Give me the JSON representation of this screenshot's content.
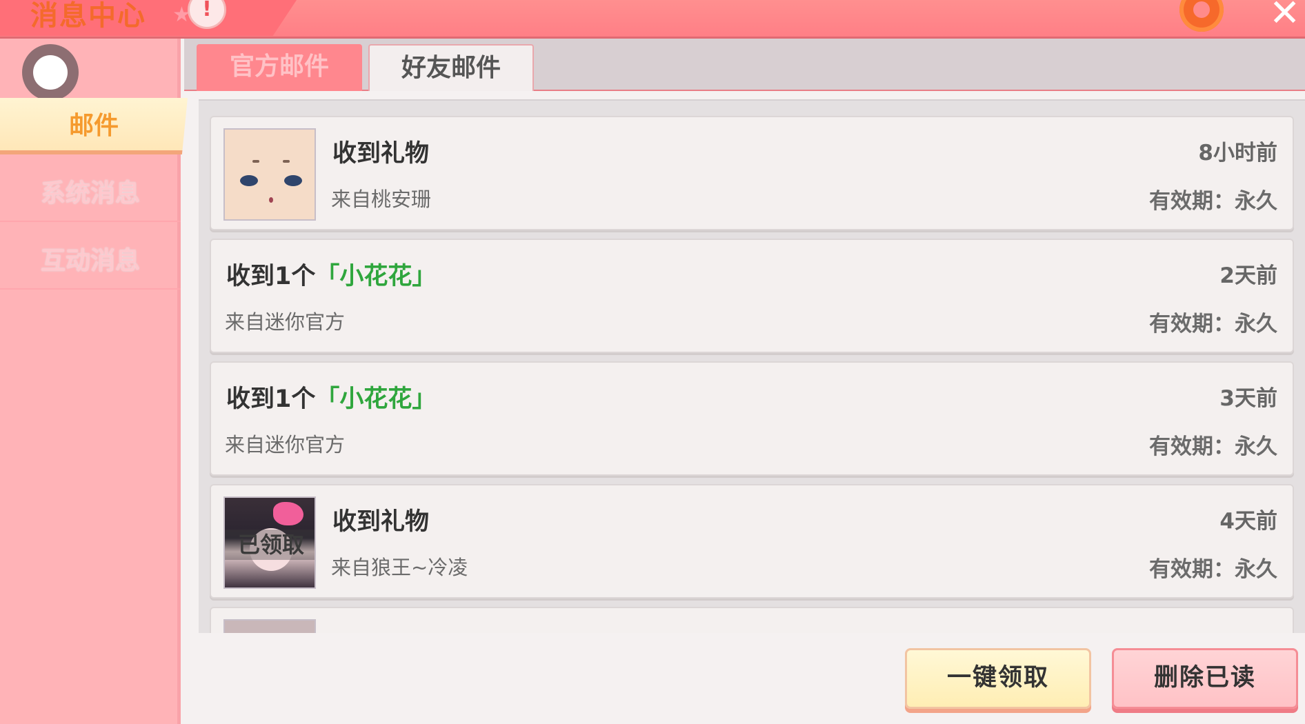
{
  "window": {
    "title": "消息中心",
    "alert_icon": "exclamation-icon",
    "settings_icon": "gear-icon",
    "close_icon": "close-icon",
    "close_glyph": "✕",
    "alert_glyph": "!"
  },
  "sidebar": {
    "items": [
      {
        "label": "邮件",
        "active": true
      },
      {
        "label": "系统消息",
        "active": false
      },
      {
        "label": "互动消息",
        "active": false
      }
    ]
  },
  "tabs": [
    {
      "label": "官方邮件",
      "active": false
    },
    {
      "label": "好友邮件",
      "active": true
    }
  ],
  "mails": [
    {
      "title": "收到礼物",
      "from": "来自桃安珊",
      "time": "8小时前",
      "validity": "有效期：永久",
      "thumb": "character-face-avatar"
    },
    {
      "title_prefix": "收到1个",
      "title_highlight": "「小花花」",
      "from": "来自迷你官方",
      "time": "2天前",
      "validity": "有效期：永久"
    },
    {
      "title_prefix": "收到1个",
      "title_highlight": "「小花花」",
      "from": "来自迷你官方",
      "time": "3天前",
      "validity": "有效期：永久"
    },
    {
      "title": "收到礼物",
      "from": "来自狼王~冷凌",
      "time": "4天前",
      "validity": "有效期：永久",
      "thumb": "character-girl-avatar",
      "status": "已领取"
    }
  ],
  "colors": {
    "title_bar": "#ff8f8f",
    "sidebar": "#ffb3b7",
    "highlight_text": "#2fa63d",
    "active_nav_text": "#f59a2e"
  },
  "buttons": {
    "claim_all": "一键领取",
    "delete_read": "删除已读"
  }
}
